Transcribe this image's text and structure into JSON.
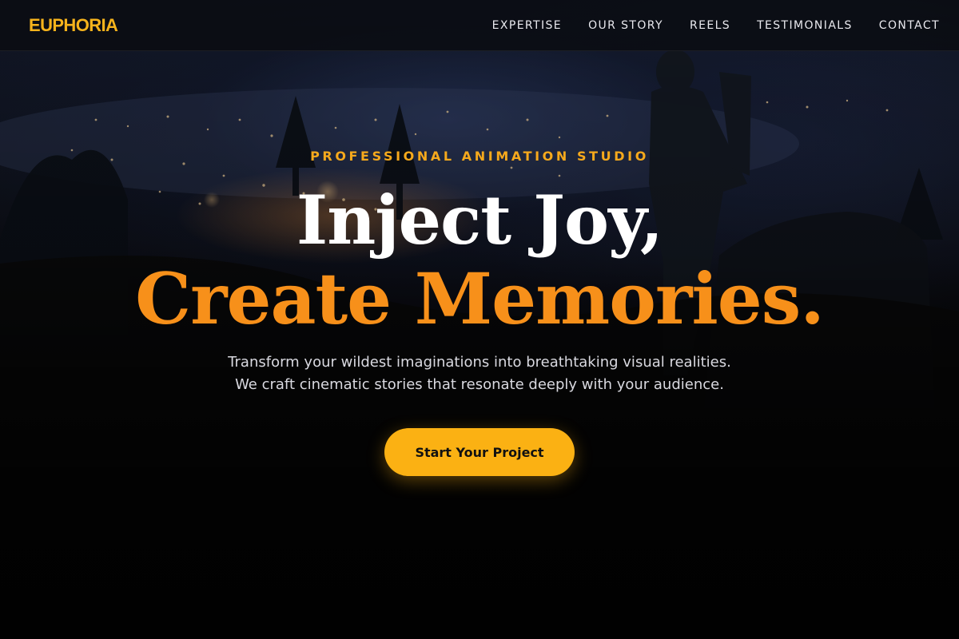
{
  "brand": {
    "logo_text": "EUPHORIA",
    "accent_color": "#f6b31c",
    "headline_accent_color": "#f7901a"
  },
  "nav": {
    "items": [
      {
        "label": "EXPERTISE"
      },
      {
        "label": "OUR STORY"
      },
      {
        "label": "REELS"
      },
      {
        "label": "TESTIMONIALS"
      },
      {
        "label": "CONTACT"
      }
    ]
  },
  "hero": {
    "eyebrow": "PROFESSIONAL ANIMATION STUDIO",
    "headline_line1": "Inject Joy,",
    "headline_line2": "Create Memories.",
    "subtext_line1": "Transform your wildest imaginations into breathtaking visual realities.",
    "subtext_line2": "We craft cinematic stories that resonate deeply with your audience.",
    "cta_label": "Start Your Project",
    "cta_color": "#fbb113"
  }
}
